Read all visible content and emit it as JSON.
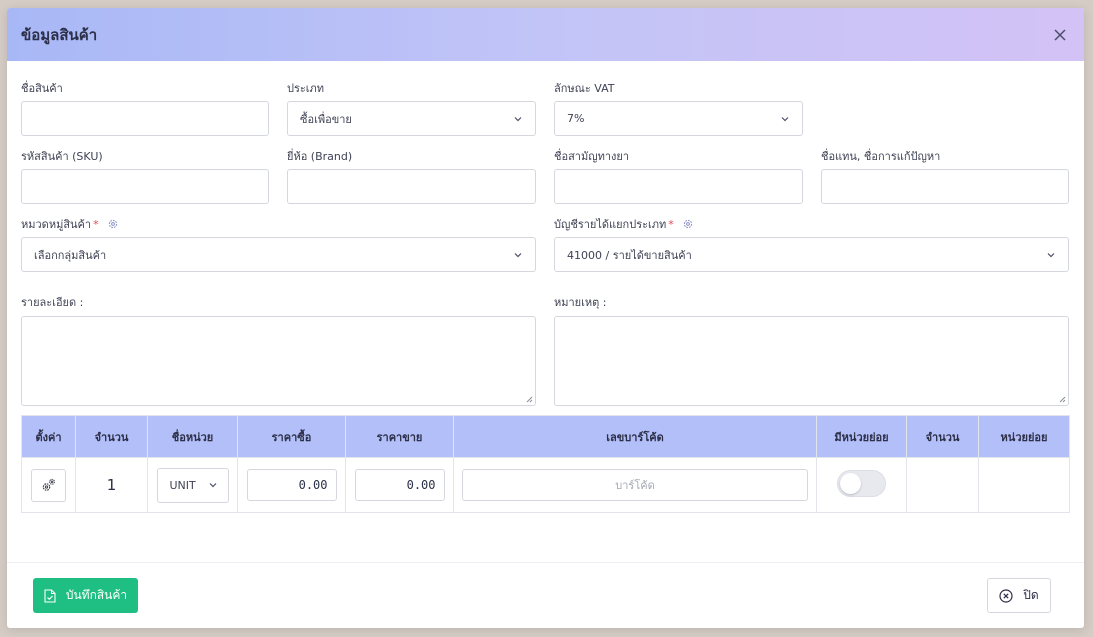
{
  "dialog": {
    "title": "ข้อมูลสินค้า"
  },
  "fields": {
    "product_name": {
      "label": "ชื่อสินค้า",
      "value": ""
    },
    "type": {
      "label": "ประเภท",
      "value": "ซื้อเพื่อขาย"
    },
    "vat": {
      "label": "ลักษณะ VAT",
      "value": "7%"
    },
    "sku": {
      "label": "รหัสสินค้า (SKU)",
      "value": ""
    },
    "brand": {
      "label": "ยี่ห้อ (Brand)",
      "value": ""
    },
    "generic_name": {
      "label": "ชื่อสามัญทางยา",
      "value": ""
    },
    "alias": {
      "label": "ชื่อแทน, ชื่อการแก้ปัญหา",
      "value": ""
    },
    "category": {
      "label": "หมวดหมู่สินค้า",
      "required_mark": "*",
      "value": "เลือกกลุ่มสินค้า"
    },
    "revenue_account": {
      "label": "บัญชีรายได้แยกประเภท",
      "required_mark": "*",
      "value": "41000 / รายได้ขายสินค้า"
    },
    "details": {
      "label": "รายละเอียด :",
      "value": ""
    },
    "remarks": {
      "label": "หมายเหตุ :",
      "value": ""
    }
  },
  "units_table": {
    "headers": [
      "ตั้งค่า",
      "จำนวน",
      "ชื่อหน่วย",
      "ราคาซื้อ",
      "ราคาขาย",
      "เลขบาร์โค้ด",
      "มีหน่วยย่อย",
      "จำนวน",
      "หน่วยย่อย"
    ],
    "rows": [
      {
        "quantity": "1",
        "unit": "UNIT",
        "buy_price": "0.00",
        "sell_price": "0.00",
        "barcode_placeholder": "บาร์โค้ด",
        "has_subunit": false,
        "sub_quantity": "",
        "subunit": ""
      }
    ]
  },
  "footer": {
    "save_label": "บันทึกสินค้า",
    "close_label": "ปิด"
  },
  "colors": {
    "header_gradient_start": "#a8b8f6",
    "header_gradient_end": "#d3c2f5",
    "save_button": "#1fbf83",
    "required": "#e5484d"
  }
}
